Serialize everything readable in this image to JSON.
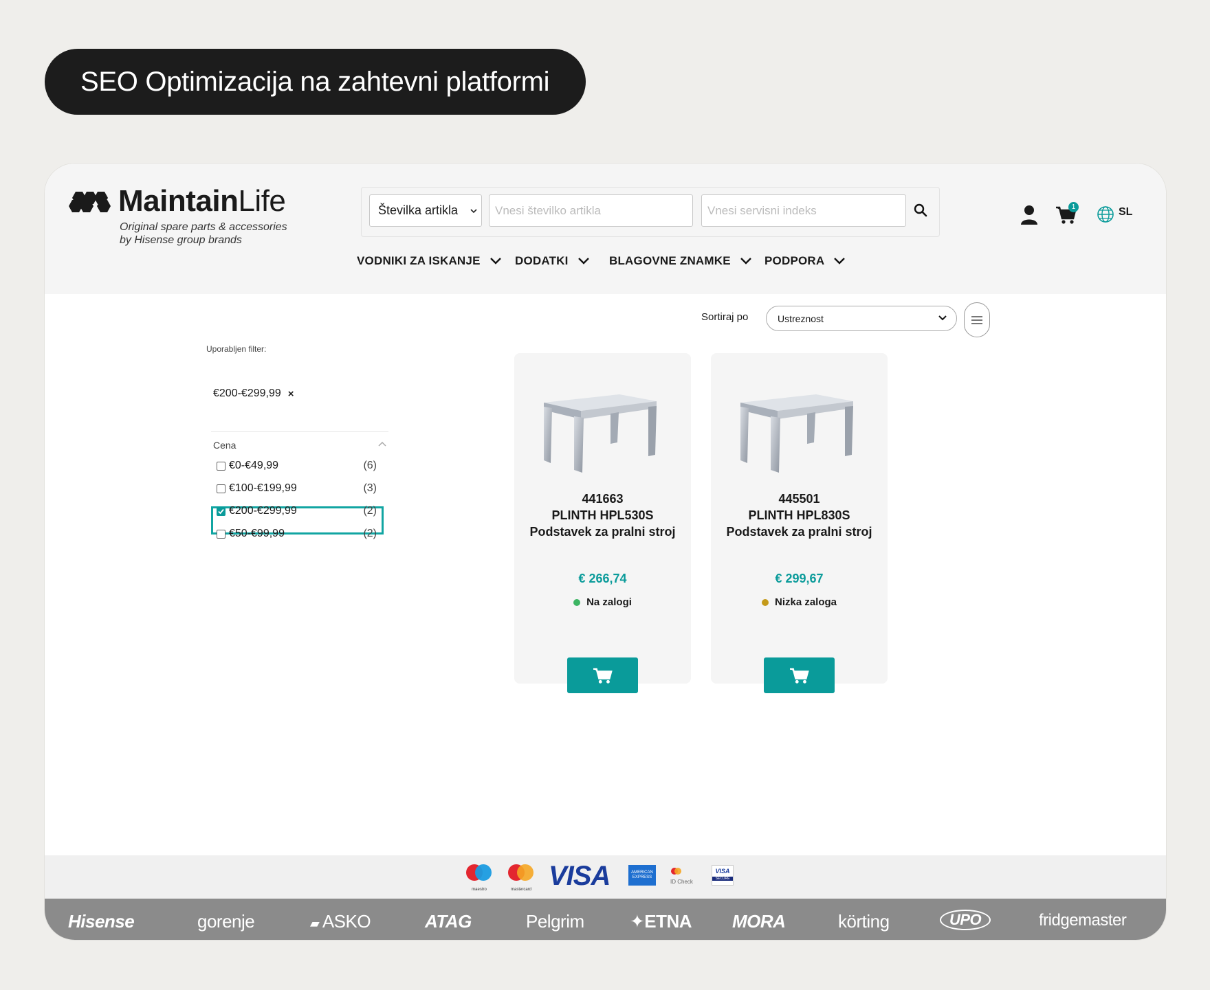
{
  "banner": {
    "title": "SEO Optimizacija na zahtevni platformi"
  },
  "header": {
    "logo_bold": "Maintain",
    "logo_light": "Life",
    "tagline_1": "Original spare parts & accessories",
    "tagline_2": "by Hisense group brands",
    "search": {
      "select_value": "Številka artikla",
      "article_placeholder": "Vnesi številko artikla",
      "service_placeholder": "Vnesi servisni indeks"
    },
    "cart_count": "1",
    "language": "SL"
  },
  "nav": {
    "items": [
      {
        "label": "VODNIKI ZA ISKANJE"
      },
      {
        "label": "DODATKI"
      },
      {
        "label": "BLAGOVNE ZNAMKE"
      },
      {
        "label": "PODPORA"
      }
    ]
  },
  "sort": {
    "label": "Sortiraj po",
    "value": "Ustreznost"
  },
  "filters": {
    "applied_title": "Uporabljen filter:",
    "applied_chip": "€200-€299,99",
    "group_title": "Cena",
    "options": [
      {
        "label": "€0-€49,99",
        "count": "(6)",
        "checked": false
      },
      {
        "label": "€100-€199,99",
        "count": "(3)",
        "checked": false
      },
      {
        "label": "€200-€299,99",
        "count": "(2)",
        "checked": true
      },
      {
        "label": "€50-€99,99",
        "count": "(2)",
        "checked": false
      }
    ]
  },
  "products": [
    {
      "sku": "441663",
      "name": "PLINTH HPL530S",
      "desc": "Podstavek za pralni stroj",
      "price": "€ 266,74",
      "stock": "Na zalogi",
      "stock_color": "#3cb563"
    },
    {
      "sku": "445501",
      "name": "PLINTH HPL830S",
      "desc": "Podstavek za pralni stroj",
      "price": "€ 299,67",
      "stock": "Nizka zaloga",
      "stock_color": "#c49a1a"
    }
  ],
  "payments": {
    "maestro": "maestro",
    "mastercard": "mastercard",
    "visa": "VISA",
    "amex": "AMERICAN EXPRESS",
    "idcheck": "ID Check",
    "visa_secure": "VISA",
    "visa_secure_sub": "SECURE"
  },
  "brands": [
    "Hisense",
    "gorenje",
    "ASKO",
    "ATAG",
    "Pelgrim",
    "ETNA",
    "MORA",
    "körting",
    "UPO",
    "fridgemaster"
  ],
  "colors": {
    "accent": "#0a9b9a",
    "dark": "#1c1c1c",
    "brand_bar": "#8b8b8b"
  }
}
